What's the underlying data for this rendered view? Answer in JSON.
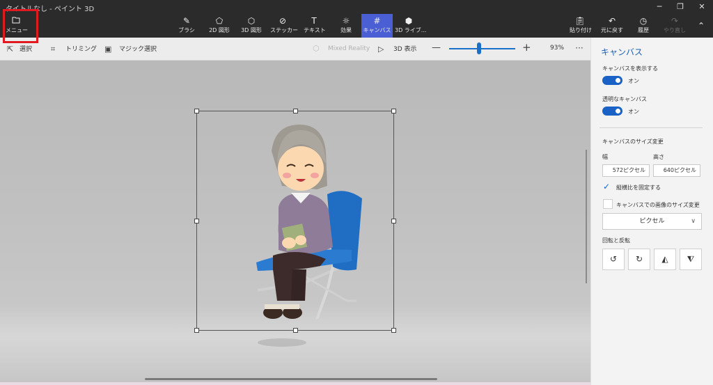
{
  "window": {
    "title": "タイトルなし - ペイント 3D",
    "minimize_icon": "minimize-icon",
    "maximize_icon": "maximize-icon",
    "close_icon": "close-icon"
  },
  "ribbon": {
    "menu_label": "メニュー",
    "tools": [
      {
        "label": "ブラシ",
        "icon": "brush-icon"
      },
      {
        "label": "2D 図形",
        "icon": "2d-shapes-icon"
      },
      {
        "label": "3D 図形",
        "icon": "3d-shapes-icon"
      },
      {
        "label": "ステッカー",
        "icon": "sticker-icon"
      },
      {
        "label": "テキスト",
        "icon": "text-icon"
      },
      {
        "label": "効果",
        "icon": "effects-icon"
      },
      {
        "label": "キャンバス",
        "icon": "canvas-icon",
        "active": true
      },
      {
        "label": "3D ライブ...",
        "icon": "3d-library-icon"
      }
    ],
    "paste_label": "貼り付け",
    "undo_label": "元に戻す",
    "history_label": "履歴",
    "redo_label": "やり直し"
  },
  "toolbar": {
    "select_label": "選択",
    "crop_label": "トリミング",
    "magic_select_label": "マジック選択",
    "mixed_reality_label": "Mixed Reality",
    "view_3d_label": "3D 表示",
    "zoom_percent": "93%",
    "zoom_level": 0.47,
    "more_label": "···"
  },
  "panel": {
    "title": "キャンバス",
    "show_canvas_label": "キャンバスを表示する",
    "show_canvas_state": "オン",
    "transparent_canvas_label": "透明なキャンバス",
    "transparent_canvas_state": "オン",
    "resize_heading": "キャンバスのサイズ変更",
    "width_label": "幅",
    "height_label": "高さ",
    "width_value": "572ピクセル",
    "height_value": "640ピクセル",
    "lock_aspect_label": "縦横比を固定する",
    "lock_aspect_checked": true,
    "resize_image_label": "キャンバスでの画像のサイズ変更",
    "resize_image_checked": false,
    "unit_value": "ピクセル",
    "rotate_flip_heading": "回転と反転"
  },
  "colors": {
    "accent": "#1a62c5",
    "active_tab": "#4a5fd4",
    "highlight_box": "#e11a22"
  }
}
